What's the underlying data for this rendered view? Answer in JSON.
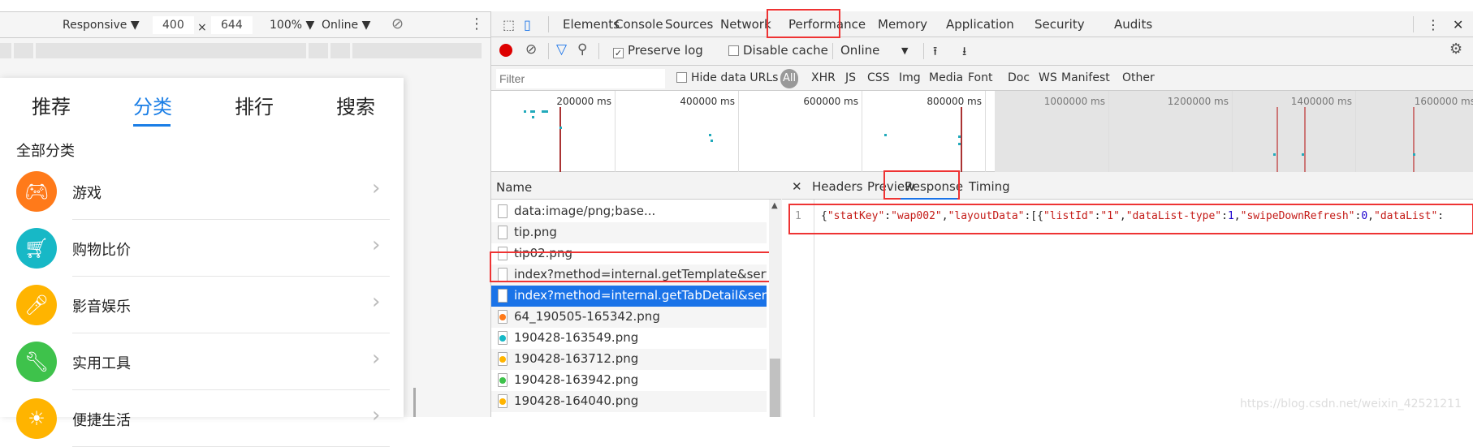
{
  "device_toolbar": {
    "device": "Responsive ▼",
    "width": "400",
    "x": "×",
    "height": "644",
    "zoom": "100% ▼",
    "throttle": "Online ▼"
  },
  "mobile": {
    "tabs": [
      "推荐",
      "分类",
      "排行",
      "搜索"
    ],
    "active_tab": "分类",
    "section_title": "全部分类",
    "categories": [
      {
        "label": "游戏",
        "icon": "gamepad-icon",
        "color": "#ff7a1a"
      },
      {
        "label": "购物比价",
        "icon": "cart-icon",
        "color": "#17b8c6"
      },
      {
        "label": "影音娱乐",
        "icon": "microphone-icon",
        "color": "#ffb400"
      },
      {
        "label": "实用工具",
        "icon": "wrench-icon",
        "color": "#3ec24b"
      },
      {
        "label": "便捷生活",
        "icon": "life-icon",
        "color": "#ffb400"
      }
    ]
  },
  "devtools": {
    "tabs": [
      "Elements",
      "Console",
      "Sources",
      "Network",
      "Performance",
      "Memory",
      "Application",
      "Security",
      "Audits"
    ],
    "active_tab": "Network",
    "toolbar": {
      "preserve_log": "Preserve log",
      "preserve_log_checked": true,
      "disable_cache": "Disable cache",
      "disable_cache_checked": false,
      "throttle": "Online"
    },
    "filter": {
      "placeholder": "Filter",
      "hide_data_urls": "Hide data URLs",
      "types": [
        "All",
        "XHR",
        "JS",
        "CSS",
        "Img",
        "Media",
        "Font",
        "Doc",
        "WS",
        "Manifest",
        "Other"
      ],
      "active_type": "All"
    },
    "timeline_ticks": [
      "200000 ms",
      "400000 ms",
      "600000 ms",
      "800000 ms",
      "1000000 ms",
      "1200000 ms",
      "1400000 ms",
      "1600000 ms"
    ],
    "name_header": "Name",
    "requests": [
      {
        "name": "data:image/png;base...",
        "dot": ""
      },
      {
        "name": "tip.png",
        "dot": ""
      },
      {
        "name": "tip02.png",
        "dot": ""
      },
      {
        "name": "index?method=internal.getTemplate&serviceType=...",
        "dot": ""
      },
      {
        "name": "index?method=internal.getTabDetail&serviceType=...",
        "dot": "",
        "selected": true
      },
      {
        "name": "64_190505-165342.png",
        "dot": "#ff7a1a"
      },
      {
        "name": "190428-163549.png",
        "dot": "#17b8c6"
      },
      {
        "name": "190428-163712.png",
        "dot": "#ffb400"
      },
      {
        "name": "190428-163942.png",
        "dot": "#3ec24b"
      },
      {
        "name": "190428-164040.png",
        "dot": "#ffb400"
      }
    ],
    "detail_tabs": [
      "Headers",
      "Preview",
      "Response",
      "Timing"
    ],
    "active_detail_tab": "Response",
    "response": {
      "line_number": "1",
      "tokens": [
        [
          "p",
          "{"
        ],
        [
          "s",
          "\"statKey\""
        ],
        [
          "p",
          ":"
        ],
        [
          "s",
          "\"wap002\""
        ],
        [
          "p",
          ","
        ],
        [
          "s",
          "\"layoutData\""
        ],
        [
          "p",
          ":[{"
        ],
        [
          "s",
          "\"listId\""
        ],
        [
          "p",
          ":"
        ],
        [
          "s",
          "\"1\""
        ],
        [
          "p",
          ","
        ],
        [
          "s",
          "\"dataList-type\""
        ],
        [
          "p",
          ":"
        ],
        [
          "n",
          "1"
        ],
        [
          "p",
          ","
        ],
        [
          "s",
          "\"swipeDownRefresh\""
        ],
        [
          "p",
          ":"
        ],
        [
          "n",
          "0"
        ],
        [
          "p",
          ","
        ],
        [
          "s",
          "\"dataList\""
        ],
        [
          "p",
          ":"
        ]
      ]
    }
  },
  "watermark": "https://blog.csdn.net/weixin_42521211"
}
